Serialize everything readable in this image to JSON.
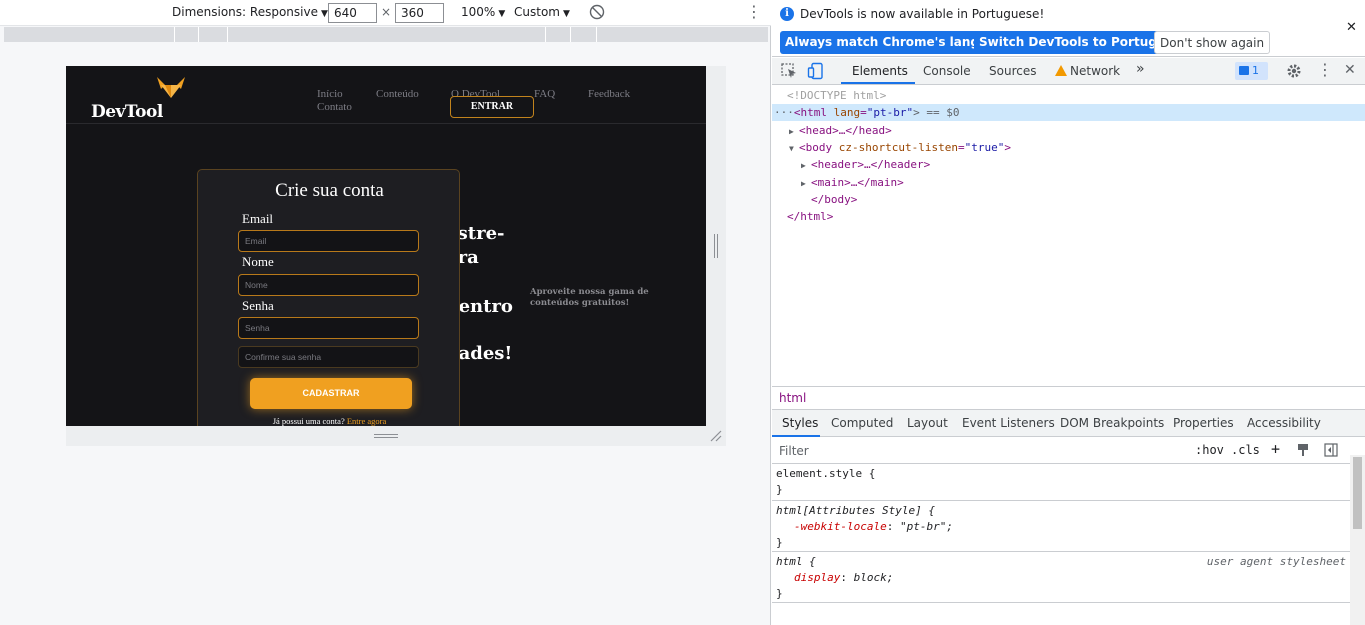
{
  "device_toolbar": {
    "dimensions_label": "Dimensions: Responsive",
    "width_value": "640",
    "times_sign": "×",
    "height_value": "360",
    "zoom_label": "100%",
    "throttle_label": "Custom"
  },
  "site": {
    "logo_text": "DevTool",
    "nav": {
      "inicio": "Início",
      "conteudo": "Conteúdo",
      "o_devtool": "O DevTool",
      "faq": "FAQ",
      "feedback": "Feedback",
      "contato": "Contato"
    },
    "entrar_label": "ENTRAR",
    "hero_lines": [
      "astre-",
      "ara",
      "dentro",
      "dades!"
    ],
    "hero_sub": "Aproveite nossa gama de conteúdos gratuitos!",
    "form": {
      "title": "Crie sua conta",
      "email_label": "Email",
      "email_placeholder": "Email",
      "nome_label": "Nome",
      "nome_placeholder": "Nome",
      "senha_label": "Senha",
      "senha_placeholder": "Senha",
      "confirm_placeholder": "Confirme sua senha",
      "submit_label": "CADASTRAR",
      "login_prompt": "Já possui uma conta?",
      "login_link": "Entre agora"
    }
  },
  "devtools": {
    "infobar": {
      "message": "DevTools is now available in Portuguese!",
      "btn_match": "Always match Chrome's language",
      "btn_switch": "Switch DevTools to Portuguese",
      "btn_dismiss": "Don't show again"
    },
    "tabs": {
      "elements": "Elements",
      "console": "Console",
      "sources": "Sources",
      "network": "Network",
      "more": "»",
      "issues_count": "1"
    },
    "dom": {
      "doctype": "<!DOCTYPE html>",
      "html_open_tag": "<html",
      "html_attr_name": "lang",
      "html_attr_value": "\"pt-br\"",
      "html_suffix": "> == $0",
      "head": "<head>…</head>",
      "body_open_tag": "<body",
      "body_attr_name": "cz-shortcut-listen",
      "body_attr_value": "\"true\"",
      "body_close_bracket": ">",
      "header": "<header>…</header>",
      "main": "<main>…</main>",
      "body_close": "</body>",
      "html_close": "</html>"
    },
    "breadcrumb": "html",
    "subtabs": {
      "styles": "Styles",
      "computed": "Computed",
      "layout": "Layout",
      "event_listeners": "Event Listeners",
      "dom_breakpoints": "DOM Breakpoints",
      "properties": "Properties",
      "accessibility": "Accessibility"
    },
    "filter": {
      "placeholder": "Filter",
      "hov": ":hov",
      "cls": ".cls",
      "plus": "+"
    },
    "styles": {
      "r1_selector": "element.style {",
      "r1_close": "}",
      "r2_selector": "html[Attributes Style] {",
      "r2_prop": "-webkit-locale",
      "r2_value": "\"pt-br\";",
      "r2_close": "}",
      "r3_selector": "html {",
      "r3_source": "user agent stylesheet",
      "r3_prop": "display",
      "r3_value": "block;",
      "r3_close": "}"
    }
  },
  "colors": {
    "accent_orange": "#f0a020",
    "devtools_blue": "#1a73e8",
    "page_bg": "#141417"
  }
}
